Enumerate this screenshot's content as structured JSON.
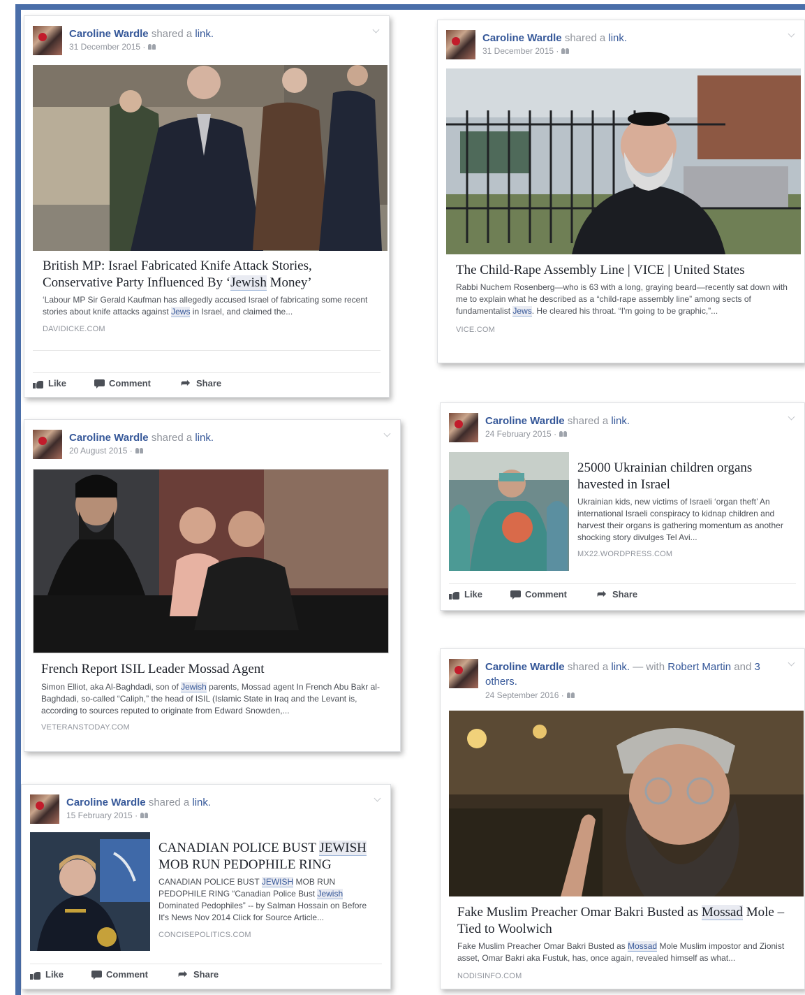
{
  "author": "Caroline Wardle",
  "shared_text": "shared a",
  "link_text": "link.",
  "actions": {
    "like": "Like",
    "comment": "Comment",
    "share": "Share"
  },
  "posts": [
    {
      "date": "31 December 2015 ·",
      "title_a": "British MP: Israel Fabricated Knife Attack Stories, Conservative Party Influenced By ‘",
      "title_hl": "Jewish",
      "title_b": " Money’",
      "desc_a": "‘Labour MP Sir Gerald Kaufman has allegedly accused Israel of fabricating some recent stories about knife attacks against ",
      "desc_hl": "Jews",
      "desc_b": " in Israel, and claimed the...",
      "domain": "DAVIDICKE.COM"
    },
    {
      "date": "31 December 2015 ·",
      "title": "The Child-Rape Assembly Line | VICE | United States",
      "desc_a": "Rabbi Nuchem Rosenberg—who is 63 with a long, graying beard—recently sat down with me to explain what he described as a “child-rape assembly line” among sects of fundamentalist ",
      "desc_hl": "Jews",
      "desc_b": ". He cleared his throat. “I'm going to be graphic,”...",
      "domain": "VICE.COM"
    },
    {
      "date": "20 August 2015 ·",
      "title": "French Report ISIL Leader Mossad Agent",
      "desc_a": "Simon Elliot, aka Al-Baghdadi, son of ",
      "desc_hl": "Jewish",
      "desc_b": " parents, Mossad agent In French Abu Bakr al-Baghdadi, so-called “Caliph,” the head of ISIL (Islamic State in Iraq and the Levant is, according to sources reputed to originate from Edward Snowden,...",
      "domain": "VETERANSTODAY.COM"
    },
    {
      "date": "24 February 2015 ·",
      "title": "25000 Ukrainian children organs havested in Israel",
      "desc": "Ukrainian kids, new victims of Israeli ‘organ theft’ An international Israeli conspiracy to kidnap children and harvest their organs is gathering momentum as another shocking story divulges Tel Avi...",
      "domain": "MX22.WORDPRESS.COM"
    },
    {
      "date": "15 February 2015 ·",
      "title_a": "CANADIAN POLICE BUST ",
      "title_hl": "JEWISH",
      "title_b": " MOB RUN PEDOPHILE RING",
      "desc_a": "CANADIAN POLICE BUST ",
      "desc_hl1": "JEWISH",
      "desc_b": " MOB RUN PEDOPHILE RING “Canadian Police Bust ",
      "desc_hl2": "Jewish",
      "desc_c": " Dominated Pedophiles” -- by Salman Hossain on Before It's News Nov 2014 Click for Source Article...",
      "domain": "CONCISEPOLITICS.COM"
    },
    {
      "date": "24 September 2016 ·",
      "with_text": "— with",
      "tagged": "Robert Martin",
      "and_text": "and",
      "others": "3 others.",
      "title_a": "Fake Muslim Preacher Omar Bakri Busted as ",
      "title_hl": "Mossad",
      "title_b": " Mole – Tied to Woolwich",
      "desc_a": "Fake Muslim Preacher Omar Bakri Busted as ",
      "desc_hl": "Mossad",
      "desc_b": " Mole Muslim impostor and Zionist asset, Omar Bakri aka Fustuk, has, once again, revealed himself as what...",
      "domain": "NODISINFO.COM"
    }
  ]
}
